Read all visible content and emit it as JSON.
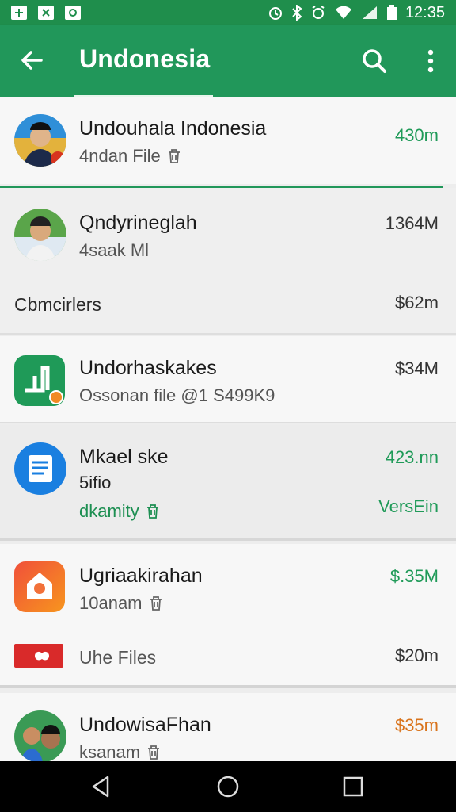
{
  "status_bar": {
    "time": "12:35",
    "left_icons": [
      "gallery-icon",
      "close-box-icon",
      "photo-icon"
    ],
    "right_icons": [
      "alarm-icon",
      "bluetooth-icon",
      "alarm-clock-icon",
      "wifi-icon",
      "signal-icon",
      "battery-icon"
    ]
  },
  "app_bar": {
    "title": "Undonesia",
    "back_icon": "arrow-back-icon",
    "search_icon": "search-icon",
    "menu_icon": "more-vert-icon"
  },
  "items": [
    {
      "name": "Undouhala Indonesia",
      "sub": "4ndan File",
      "size": "430m",
      "size_color": "#1f9a58",
      "icon": "avatar-photo"
    },
    {
      "name": "Qndyrineglah",
      "sub": "4saak Ml",
      "size": "1364M",
      "size_color": "#333333",
      "icon": "avatar-photo"
    },
    {
      "name": "Undorhaskakes",
      "sub": "Ossonan file @1 S499K9",
      "size": "$34M",
      "size_color": "#333333",
      "icon": "green-app-icon"
    },
    {
      "name": "Mkael ske",
      "sub2": "5ifio",
      "sub": "dkamity",
      "size": "423.nn",
      "size_extra": "VersEin",
      "size_color": "#1f9a58",
      "icon": "blue-doc-icon"
    },
    {
      "name": "Ugriaakirahan",
      "sub": "10anam",
      "size": "$.35M",
      "size_color": "#1f9a58",
      "icon": "orange-app-icon"
    },
    {
      "name": "UndowisaFhan",
      "sub": "ksanam",
      "size": "$35m",
      "size_color": "#d9731b",
      "icon": "avatar-photo"
    }
  ],
  "sections": [
    {
      "label": "Cbmcirlers",
      "size": "$62m"
    },
    {
      "label": "Uhe Files",
      "size": "$20m"
    }
  ],
  "colors": {
    "primary": "#21975a",
    "status_bar": "#1f8e4c",
    "accent_green": "#1f9a58",
    "accent_orange": "#d9731b"
  },
  "nav_bar": {
    "icons": [
      "back-triangle-icon",
      "home-circle-icon",
      "recents-square-icon"
    ]
  }
}
